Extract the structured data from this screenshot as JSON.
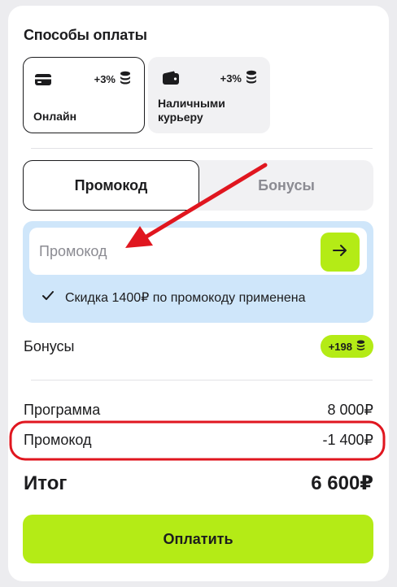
{
  "payment": {
    "title": "Способы оплаты",
    "options": [
      {
        "label": "Онлайн",
        "bonus": "+3%",
        "icon": "card-icon",
        "selected": true
      },
      {
        "label": "Наличными\nкурьеру",
        "bonus": "+3%",
        "icon": "wallet-icon",
        "selected": false
      }
    ]
  },
  "tabs": [
    {
      "label": "Промокод",
      "active": true
    },
    {
      "label": "Бонусы",
      "active": false
    }
  ],
  "promo": {
    "placeholder": "Промокод",
    "status": "Скидка 1400₽ по промокоду применена",
    "submit_icon": "arrow-right-icon"
  },
  "bonuses": {
    "label": "Бонусы",
    "pill": "+198"
  },
  "summary": {
    "program_label": "Программа",
    "program_value": "8 000₽",
    "promo_label": "Промокод",
    "promo_value": "-1 400₽",
    "total_label": "Итог",
    "total_value": "6 600₽"
  },
  "pay_button": "Оплатить",
  "colors": {
    "accent": "#b4eb16",
    "promo_bg": "#cfe6fa",
    "annotation": "#e0161f"
  }
}
